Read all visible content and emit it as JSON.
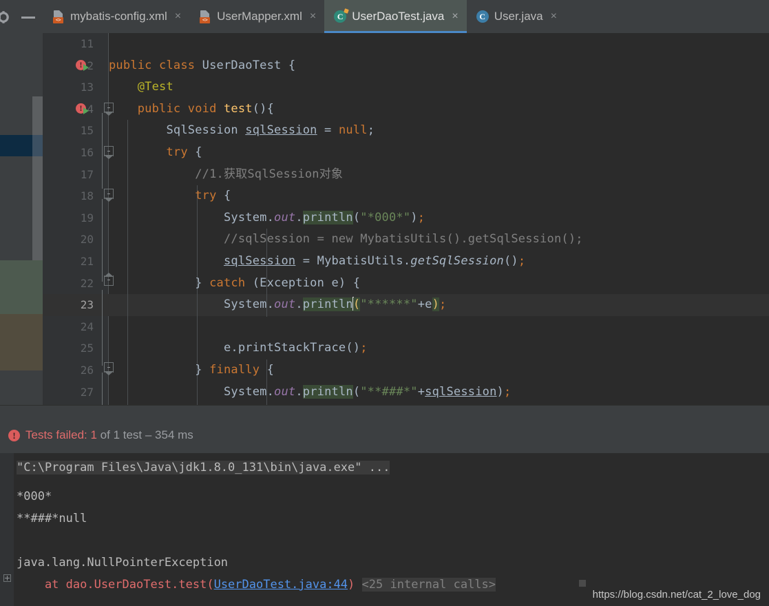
{
  "window": {
    "gear_icon": "gear-icon",
    "minimize_icon": "minimize-icon"
  },
  "tabs": [
    {
      "label": "mybatis-config.xml",
      "icon": "xml-file-icon",
      "icon_text": "<>",
      "active": false,
      "close": "×"
    },
    {
      "label": "UserMapper.xml",
      "icon": "xml-file-icon",
      "icon_text": "<>",
      "active": false,
      "close": "×"
    },
    {
      "label": "UserDaoTest.java",
      "icon": "java-test-class-icon",
      "icon_text": "C",
      "active": true,
      "close": "×"
    },
    {
      "label": "User.java",
      "icon": "java-class-icon",
      "icon_text": "C",
      "active": false,
      "close": "×"
    }
  ],
  "editor": {
    "file": "UserDaoTest.java",
    "current_line": 23,
    "first_visible_line": 11,
    "last_visible_line": 27,
    "lines": [
      {
        "n": 11,
        "text": ""
      },
      {
        "n": 12,
        "text": "public class UserDaoTest {"
      },
      {
        "n": 13,
        "text": "    @Test"
      },
      {
        "n": 14,
        "text": "    public void test(){"
      },
      {
        "n": 15,
        "text": "        SqlSession sqlSession = null;"
      },
      {
        "n": 16,
        "text": "        try {"
      },
      {
        "n": 17,
        "text": "            //1.获取SqlSession对象"
      },
      {
        "n": 18,
        "text": "            try {"
      },
      {
        "n": 19,
        "text": "                System.out.println(\"*000*\");"
      },
      {
        "n": 20,
        "text": "                //sqlSession = new MybatisUtils().getSqlSession();"
      },
      {
        "n": 21,
        "text": "                sqlSession = MybatisUtils.getSqlSession();"
      },
      {
        "n": 22,
        "text": "            } catch (Exception e) {"
      },
      {
        "n": 23,
        "text": "                System.out.println(\"******\"+e);"
      },
      {
        "n": 24,
        "text": ""
      },
      {
        "n": 25,
        "text": "                e.printStackTrace();"
      },
      {
        "n": 26,
        "text": "            } finally {"
      },
      {
        "n": 27,
        "text": "                System.out.println(\"**###*\"+sqlSession);"
      }
    ]
  },
  "test_results": {
    "icon": "error-icon",
    "failed_label": "Tests failed: 1",
    "detail_label": " of 1 test – 354 ms"
  },
  "console": {
    "command": "\"C:\\Program Files\\Java\\jdk1.8.0_131\\bin\\java.exe\" ...",
    "out_1": "*000*",
    "out_2": "**###*null",
    "exception": "java.lang.NullPointerException",
    "stack_prefix": "    at dao.UserDaoTest.test(",
    "stack_link": "UserDaoTest.java:44",
    "stack_suffix": ")",
    "internal_calls": "<25 internal calls>",
    "expand_icon": "expand-plus-icon"
  },
  "watermark": {
    "text": "https://blog.csdn.net/cat_2_love_dog"
  },
  "colors": {
    "accent_blue": "#4a88c7",
    "error_red": "#e06c6c",
    "keyword_orange": "#cc7832",
    "string_green": "#6a8759",
    "link_blue": "#5394ec",
    "active_tab_bg": "#4e5754"
  }
}
